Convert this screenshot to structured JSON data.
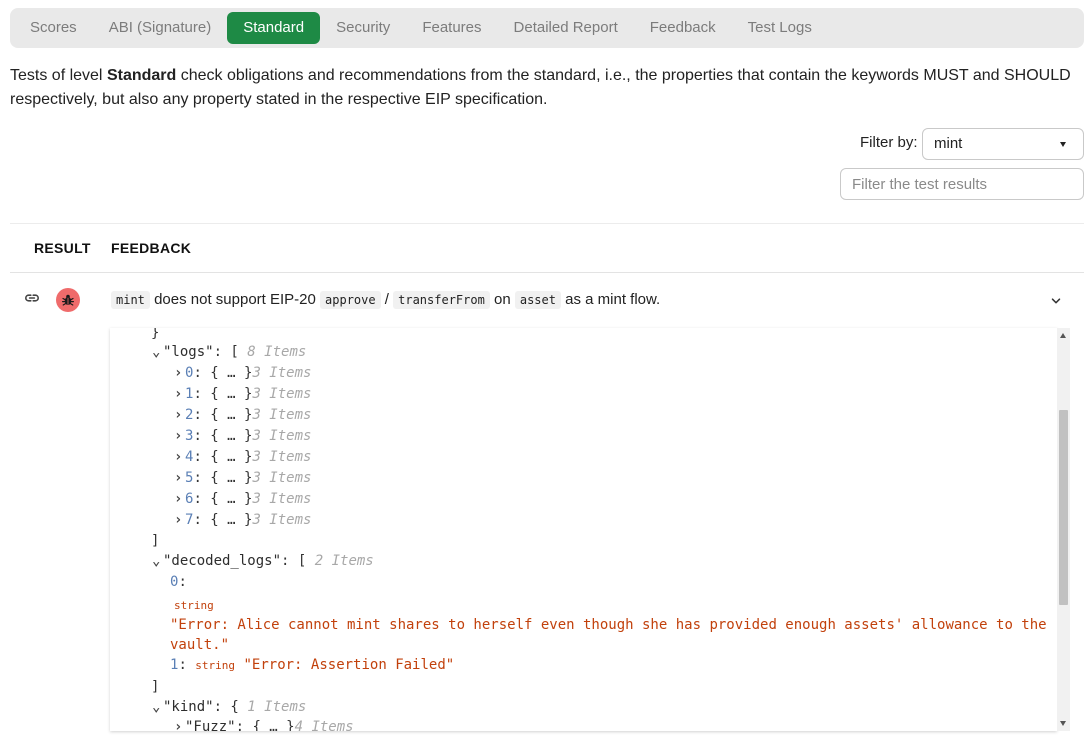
{
  "tabs": [
    {
      "label": "Scores",
      "active": false
    },
    {
      "label": "ABI (Signature)",
      "active": false
    },
    {
      "label": "Standard",
      "active": true
    },
    {
      "label": "Security",
      "active": false
    },
    {
      "label": "Features",
      "active": false
    },
    {
      "label": "Detailed Report",
      "active": false
    },
    {
      "label": "Feedback",
      "active": false
    },
    {
      "label": "Test Logs",
      "active": false
    }
  ],
  "intro": {
    "pre": "Tests of level ",
    "bold": "Standard",
    "post": " check obligations and recommendations from the standard, i.e., the properties that contain the keywords MUST and SHOULD respectively, but also any property stated in the respective EIP specification."
  },
  "filter": {
    "label": "Filter by:",
    "selected": "mint",
    "search_placeholder": "Filter the test results"
  },
  "table": {
    "col_result": "RESULT",
    "col_feedback": "FEEDBACK"
  },
  "row": {
    "result_icon": "bug-icon",
    "text": {
      "c1": "mint",
      "t1": "does not support EIP-20",
      "c2": "approve",
      "t2": "/",
      "c3": "transferFrom",
      "t3": "on",
      "c4": "asset",
      "t4": "as a mint flow."
    }
  },
  "json_view": {
    "top_brace": "}",
    "logs_key": "\"logs\"",
    "logs_count": "8 Items",
    "log_items": [
      {
        "index": "0",
        "count": "3 Items"
      },
      {
        "index": "1",
        "count": "3 Items"
      },
      {
        "index": "2",
        "count": "3 Items"
      },
      {
        "index": "3",
        "count": "3 Items"
      },
      {
        "index": "4",
        "count": "3 Items"
      },
      {
        "index": "5",
        "count": "3 Items"
      },
      {
        "index": "6",
        "count": "3 Items"
      },
      {
        "index": "7",
        "count": "3 Items"
      }
    ],
    "collapsed": "{ … }",
    "close_bracket": "]",
    "decoded_key": "\"decoded_logs\"",
    "decoded_count": "2 Items",
    "d0_index": "0",
    "d0_type": "string",
    "d0_value_line1": "\"Error: Alice cannot mint shares to herself even though she has provided enough assets' allowance to the",
    "d0_value_line2": "vault.\"",
    "d1_index": "1",
    "d1_type": "string",
    "d1_value": "\"Error: Assertion Failed\"",
    "kind_key": "\"kind\"",
    "kind_count": "1 Items",
    "fuzz_key": "\"Fuzz\"",
    "fuzz_count": "4 Items"
  },
  "colors": {
    "active_tab": "#1e8a45",
    "bug_badge": "#ef6b6b",
    "string_value": "#c2410c",
    "index": "#5a7fb5"
  }
}
